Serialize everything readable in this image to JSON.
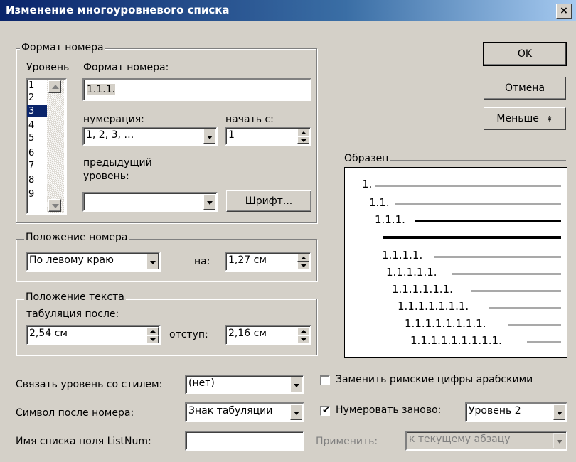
{
  "dialog": {
    "title": "Изменение многоуровневого списка",
    "close_glyph": "×"
  },
  "number_format": {
    "group_label": "Формат номера",
    "level_label": "Уровень",
    "format_label": "Формат номера:",
    "format_value": "1.1.1.",
    "levels": [
      "1",
      "2",
      "3",
      "4",
      "5",
      "6",
      "7",
      "8",
      "9"
    ],
    "selected_level": "3",
    "numbering_label": "нумерация:",
    "numbering_value": "1, 2, 3, …",
    "start_label": "начать с:",
    "start_value": "1",
    "prev_level_label_line1": "предыдущий",
    "prev_level_label_line2": "уровень:",
    "prev_level_value": "",
    "font_button": "Шрифт..."
  },
  "number_position": {
    "group_label": "Положение номера",
    "align_value": "По левому краю",
    "at_label": "на:",
    "at_value": "1,27 см"
  },
  "text_position": {
    "group_label": "Положение текста",
    "tab_after_label": "табуляция после:",
    "tab_after_value": "2,54 см",
    "indent_label": "отступ:",
    "indent_value": "2,16 см"
  },
  "buttons": {
    "ok": "OK",
    "cancel": "Отмена",
    "less": "Меньше",
    "less_glyph": "⇞"
  },
  "preview": {
    "group_label": "Образец",
    "lines": [
      "1.",
      "1.1.",
      "1.1.1.",
      "",
      "1.1.1.1.",
      "1.1.1.1.1.",
      "1.1.1.1.1.1.",
      "1.1.1.1.1.1.1.",
      "1.1.1.1.1.1.1.1.",
      "1.1.1.1.1.1.1.1.1."
    ]
  },
  "bottom": {
    "link_style_label": "Связать уровень со стилем:",
    "link_style_value": "(нет)",
    "after_number_label": "Символ после номера:",
    "after_number_value": "Знак табуляции",
    "listnum_label": "Имя списка поля ListNum:",
    "listnum_value": "",
    "replace_roman_label": "Заменить римские цифры арабскими",
    "replace_roman_checked": false,
    "restart_label": "Нумеровать заново:",
    "restart_checked": true,
    "restart_value": "Уровень 2",
    "apply_label": "Применить:",
    "apply_value": "к текущему абзацу"
  }
}
